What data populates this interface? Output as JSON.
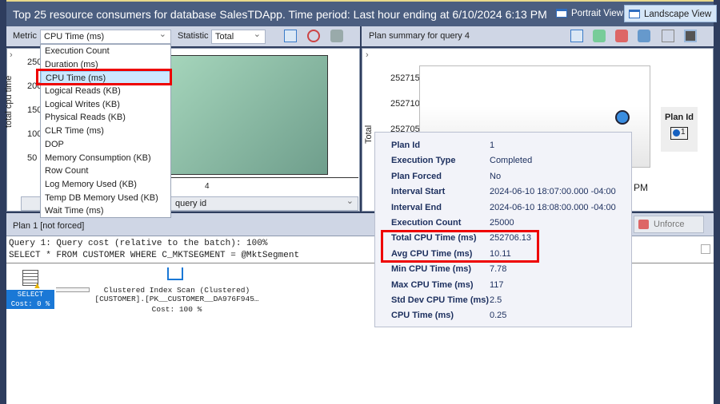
{
  "title": "Top 25 resource consumers for database SalesTDApp. Time period: Last hour ending at 6/10/2024 6:13 PM",
  "views": {
    "portrait": "Portrait View",
    "landscape": "Landscape View"
  },
  "left": {
    "metric_label": "Metric",
    "metric_value": "CPU Time (ms)",
    "statistic_label": "Statistic",
    "statistic_value": "Total",
    "metric_options": [
      "Execution Count",
      "Duration (ms)",
      "CPU Time (ms)",
      "Logical Reads (KB)",
      "Logical Writes (KB)",
      "Physical Reads (KB)",
      "CLR Time (ms)",
      "DOP",
      "Memory Consumption (KB)",
      "Row Count",
      "Log Memory Used (KB)",
      "Temp DB Memory Used (KB)",
      "Wait Time (ms)"
    ],
    "y_axis_label": "total cpu time",
    "y_ticks": [
      "250",
      "200",
      "150",
      "100",
      "50"
    ],
    "x_tick": "4",
    "x_axis_select": "query id"
  },
  "right": {
    "header": "Plan summary for query 4",
    "y_axis_label": "Total",
    "y_ticks": [
      "252715",
      "252710",
      "252705"
    ],
    "x_tick_partial": "PM",
    "legend_title": "Plan Id",
    "legend_item": "1",
    "unforce_label": "Unforce Plan"
  },
  "tooltip": [
    {
      "k": "Plan Id",
      "v": "1"
    },
    {
      "k": "Execution Type",
      "v": "Completed"
    },
    {
      "k": "Plan Forced",
      "v": "No"
    },
    {
      "k": "Interval Start",
      "v": "2024-06-10 18:07:00.000 -04:00"
    },
    {
      "k": "Interval End",
      "v": "2024-06-10 18:08:00.000 -04:00"
    },
    {
      "k": "Execution Count",
      "v": "25000"
    },
    {
      "k": "Total CPU Time (ms)",
      "v": "252706.13"
    },
    {
      "k": "Avg CPU Time (ms)",
      "v": "10.11"
    },
    {
      "k": "Min CPU Time (ms)",
      "v": "7.78"
    },
    {
      "k": "Max CPU Time (ms)",
      "v": "117"
    },
    {
      "k": "Std Dev CPU Time (ms)",
      "v": "2.5"
    },
    {
      "k": "CPU Time (ms)",
      "v": "0.25"
    }
  ],
  "plan": {
    "header": "Plan 1 [not forced]",
    "query_line1": "Query 1: Query cost (relative to the batch): 100%",
    "query_line2": "SELECT * FROM CUSTOMER WHERE C_MKTSEGMENT = @MktSegment",
    "select_label": "SELECT",
    "select_cost": "Cost: 0 %",
    "op_name": "Clustered Index Scan (Clustered)",
    "op_object": "[CUSTOMER].[PK__CUSTOMER__DA976F945…",
    "op_cost": "Cost: 100 %"
  }
}
